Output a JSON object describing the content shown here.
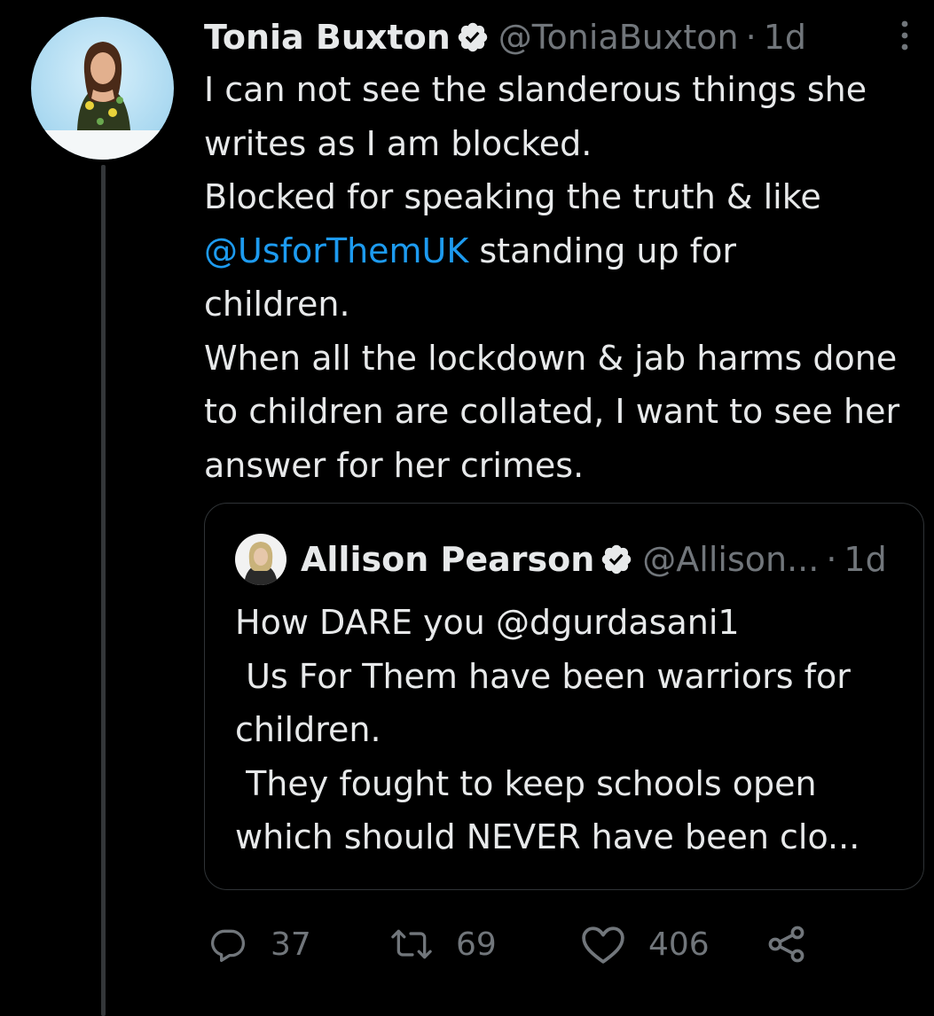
{
  "tweet": {
    "author_name": "Tonia Buxton",
    "author_handle": "@ToniaBuxton",
    "separator": "·",
    "time": "1d",
    "body_lines": [
      "I can not see the slanderous things she",
      "writes as I am blocked.",
      "Blocked for speaking the truth & like"
    ],
    "mention": "@UsforThemUK",
    "mention_suffix": " standing up for",
    "body_lines_after": [
      "children.",
      "When all the lockdown & jab harms done",
      "to children are collated, I want to see her",
      "answer for her crimes."
    ]
  },
  "quote": {
    "author_name": "Allison Pearson",
    "author_handle": "@Allison...",
    "separator": "·",
    "time": "1d",
    "body": "How DARE you @dgurdasani1\n Us For Them have been warriors for\nchildren.\n They fought to keep schools open\nwhich should NEVER have been clo..."
  },
  "actions": {
    "replies": "37",
    "retweets": "69",
    "likes": "406"
  },
  "icons": {
    "avatar": "avatar-photo",
    "verified": "verified-badge-icon",
    "more": "more-vertical-icon",
    "reply": "reply-icon",
    "retweet": "retweet-icon",
    "like": "heart-icon",
    "share": "share-icon"
  },
  "colors": {
    "background": "#000000",
    "text": "#e7e9ea",
    "secondary": "#71767b",
    "link": "#1d9bf0",
    "border": "#2f3336"
  }
}
